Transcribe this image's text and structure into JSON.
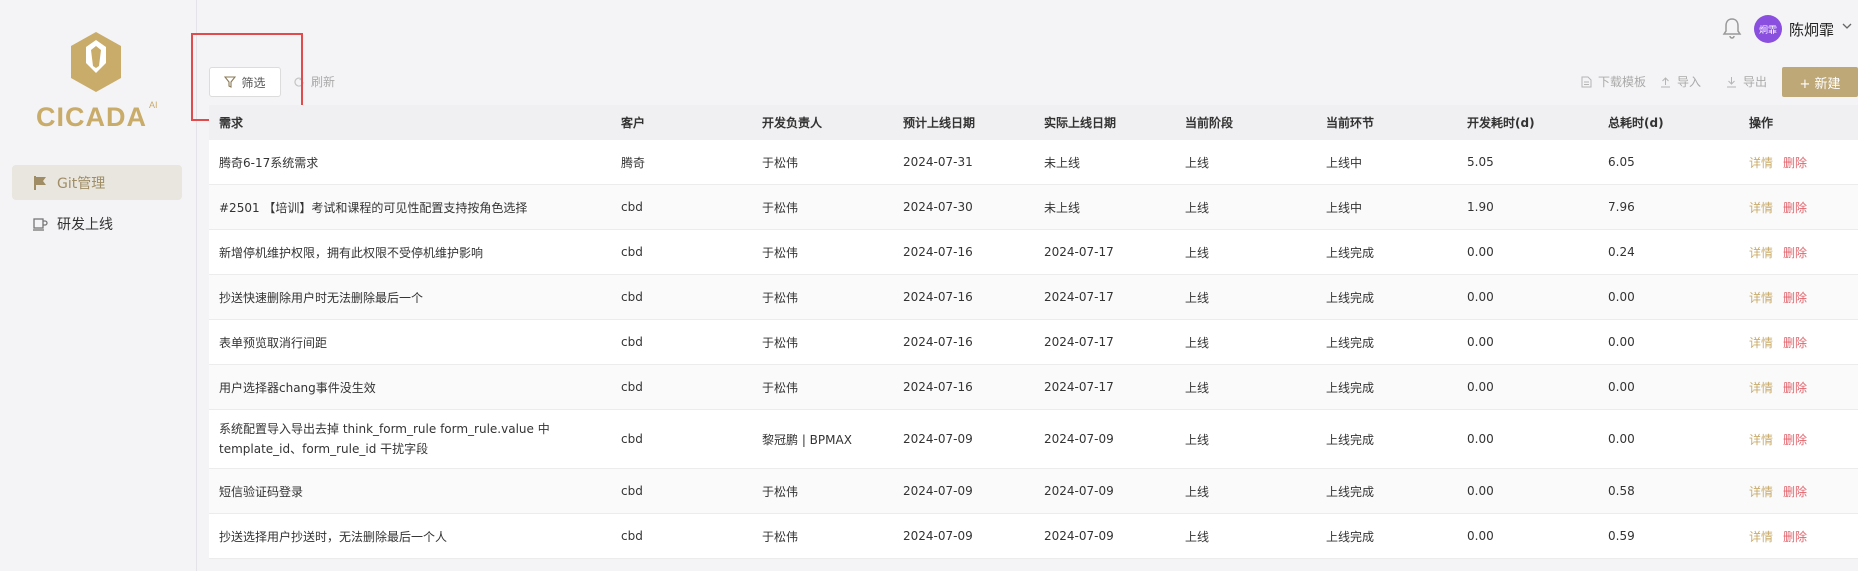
{
  "brand": {
    "name": "CICADA",
    "suffix": "AI",
    "colors": {
      "accent": "#bfa877",
      "delete": "#e0646c",
      "highlight": "#e24b4b",
      "avatar": "#8b4fe0"
    }
  },
  "sidebar": {
    "items": [
      {
        "label": "Git管理",
        "icon": "flag-icon",
        "active": true
      },
      {
        "label": "研发上线",
        "icon": "cup-icon",
        "active": false
      }
    ]
  },
  "header": {
    "user": {
      "name": "陈炯霏",
      "avatar_text": "炯霏"
    }
  },
  "toolbar": {
    "filter_label": "筛选",
    "refresh_label": "刷新",
    "download_template_label": "下载模板",
    "import_label": "导入",
    "export_label": "导出",
    "new_label": "+ 新建"
  },
  "table": {
    "columns": [
      "需求",
      "客户",
      "开发负责人",
      "预计上线日期",
      "实际上线日期",
      "当前阶段",
      "当前环节",
      "开发耗时(d)",
      "总耗时(d)",
      "操作"
    ],
    "action_detail": "详情",
    "action_delete": "删除",
    "rows": [
      {
        "req": "腾奇6-17系统需求",
        "client": "腾奇",
        "owner": "于松伟",
        "planned": "2024-07-31",
        "actual": "未上线",
        "stage": "上线",
        "step": "上线中",
        "dev": "5.05",
        "total": "6.05"
      },
      {
        "req": "#2501 【培训】考试和课程的可见性配置支持按角色选择",
        "client": "cbd",
        "owner": "于松伟",
        "planned": "2024-07-30",
        "actual": "未上线",
        "stage": "上线",
        "step": "上线中",
        "dev": "1.90",
        "total": "7.96"
      },
      {
        "req": "新增停机维护权限，拥有此权限不受停机维护影响",
        "client": "cbd",
        "owner": "于松伟",
        "planned": "2024-07-16",
        "actual": "2024-07-17",
        "stage": "上线",
        "step": "上线完成",
        "dev": "0.00",
        "total": "0.24"
      },
      {
        "req": "抄送快速删除用户时无法删除最后一个",
        "client": "cbd",
        "owner": "于松伟",
        "planned": "2024-07-16",
        "actual": "2024-07-17",
        "stage": "上线",
        "step": "上线完成",
        "dev": "0.00",
        "total": "0.00"
      },
      {
        "req": "表单预览取消行间距",
        "client": "cbd",
        "owner": "于松伟",
        "planned": "2024-07-16",
        "actual": "2024-07-17",
        "stage": "上线",
        "step": "上线完成",
        "dev": "0.00",
        "total": "0.00"
      },
      {
        "req": "用户选择器chang事件没生效",
        "client": "cbd",
        "owner": "于松伟",
        "planned": "2024-07-16",
        "actual": "2024-07-17",
        "stage": "上线",
        "step": "上线完成",
        "dev": "0.00",
        "total": "0.00"
      },
      {
        "req": "系统配置导入导出去掉 think_form_rule form_rule.value 中 template_id、form_rule_id 干扰字段",
        "client": "cbd",
        "owner": "黎冠鹏 | BPMAX",
        "planned": "2024-07-09",
        "actual": "2024-07-09",
        "stage": "上线",
        "step": "上线完成",
        "dev": "0.00",
        "total": "0.00"
      },
      {
        "req": "短信验证码登录",
        "client": "cbd",
        "owner": "于松伟",
        "planned": "2024-07-09",
        "actual": "2024-07-09",
        "stage": "上线",
        "step": "上线完成",
        "dev": "0.00",
        "total": "0.58"
      },
      {
        "req": "抄送选择用户抄送时，无法删除最后一个人",
        "client": "cbd",
        "owner": "于松伟",
        "planned": "2024-07-09",
        "actual": "2024-07-09",
        "stage": "上线",
        "step": "上线完成",
        "dev": "0.00",
        "total": "0.59"
      }
    ]
  }
}
